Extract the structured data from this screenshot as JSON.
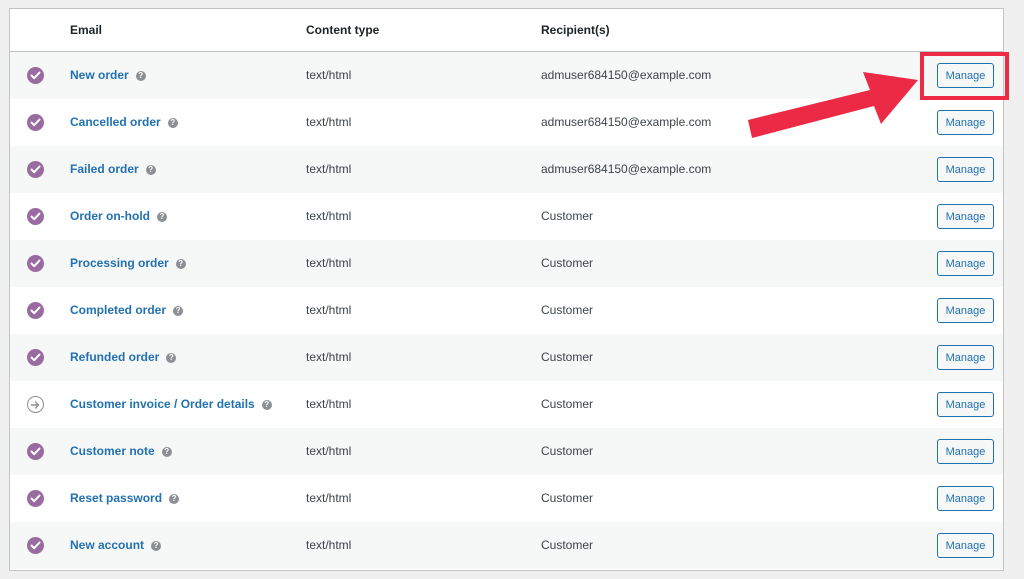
{
  "table": {
    "headers": {
      "email": "Email",
      "content_type": "Content type",
      "recipients": "Recipient(s)"
    },
    "help_glyph": "?",
    "rows": [
      {
        "status": "enabled",
        "name": "New order",
        "content_type": "text/html",
        "recipient": "admuser684150@example.com",
        "action": "Manage"
      },
      {
        "status": "enabled",
        "name": "Cancelled order",
        "content_type": "text/html",
        "recipient": "admuser684150@example.com",
        "action": "Manage"
      },
      {
        "status": "enabled",
        "name": "Failed order",
        "content_type": "text/html",
        "recipient": "admuser684150@example.com",
        "action": "Manage"
      },
      {
        "status": "enabled",
        "name": "Order on-hold",
        "content_type": "text/html",
        "recipient": "Customer",
        "action": "Manage"
      },
      {
        "status": "enabled",
        "name": "Processing order",
        "content_type": "text/html",
        "recipient": "Customer",
        "action": "Manage"
      },
      {
        "status": "enabled",
        "name": "Completed order",
        "content_type": "text/html",
        "recipient": "Customer",
        "action": "Manage"
      },
      {
        "status": "enabled",
        "name": "Refunded order",
        "content_type": "text/html",
        "recipient": "Customer",
        "action": "Manage"
      },
      {
        "status": "manual",
        "name": "Customer invoice / Order details",
        "content_type": "text/html",
        "recipient": "Customer",
        "action": "Manage"
      },
      {
        "status": "enabled",
        "name": "Customer note",
        "content_type": "text/html",
        "recipient": "Customer",
        "action": "Manage"
      },
      {
        "status": "enabled",
        "name": "Reset password",
        "content_type": "text/html",
        "recipient": "Customer",
        "action": "Manage"
      },
      {
        "status": "enabled",
        "name": "New account",
        "content_type": "text/html",
        "recipient": "Customer",
        "action": "Manage"
      }
    ]
  },
  "annotation": {
    "highlight_color": "#ec2a45",
    "highlighted_row": 0
  },
  "colors": {
    "link": "#2271b1",
    "enabled_status": "#9a6ba0",
    "alt_row": "#f6f7f7"
  }
}
